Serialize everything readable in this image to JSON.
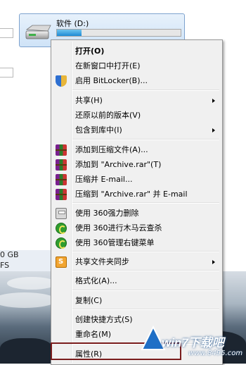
{
  "explorer": {
    "drive_label": "软件 (D:)",
    "drive_usage_fraction": 0.2,
    "detail_line1": "0 GB",
    "detail_line2": "FS"
  },
  "menu": {
    "items": [
      {
        "label": "打开(O)",
        "bold": true,
        "icon": null,
        "submenu": false
      },
      {
        "label": "在新窗口中打开(E)",
        "icon": null,
        "submenu": false
      },
      {
        "label": "启用 BitLocker(B)...",
        "icon": "shield-icon",
        "submenu": false
      },
      {
        "label": "共享(H)",
        "icon": null,
        "submenu": true
      },
      {
        "label": "还原以前的版本(V)",
        "icon": null,
        "submenu": false
      },
      {
        "label": "包含到库中(I)",
        "icon": null,
        "submenu": true
      },
      {
        "label": "添加到压缩文件(A)...",
        "icon": "winrar-icon",
        "submenu": false
      },
      {
        "label": "添加到 \"Archive.rar\"(T)",
        "icon": "winrar-icon",
        "submenu": false
      },
      {
        "label": "压缩并 E-mail...",
        "icon": "winrar-icon",
        "submenu": false
      },
      {
        "label": "压缩到 \"Archive.rar\" 并 E-mail",
        "icon": "winrar-icon",
        "submenu": false
      },
      {
        "label": "使用 360强力删除",
        "icon": "shredder-icon",
        "submenu": false
      },
      {
        "label": "使用 360进行木马云查杀",
        "icon": "360-icon",
        "submenu": false
      },
      {
        "label": "使用 360管理右键菜单",
        "icon": "360-icon",
        "submenu": false
      },
      {
        "label": "共享文件夹同步",
        "icon": "sync-icon",
        "submenu": true
      },
      {
        "label": "格式化(A)...",
        "icon": null,
        "submenu": false
      },
      {
        "label": "复制(C)",
        "icon": null,
        "submenu": false
      },
      {
        "label": "创建快捷方式(S)",
        "icon": null,
        "submenu": false
      },
      {
        "label": "重命名(M)",
        "icon": null,
        "submenu": false
      },
      {
        "label": "属性(R)",
        "icon": null,
        "submenu": false
      }
    ]
  },
  "watermark": {
    "main": "win7下载吧",
    "sub": "www.8495.com"
  }
}
